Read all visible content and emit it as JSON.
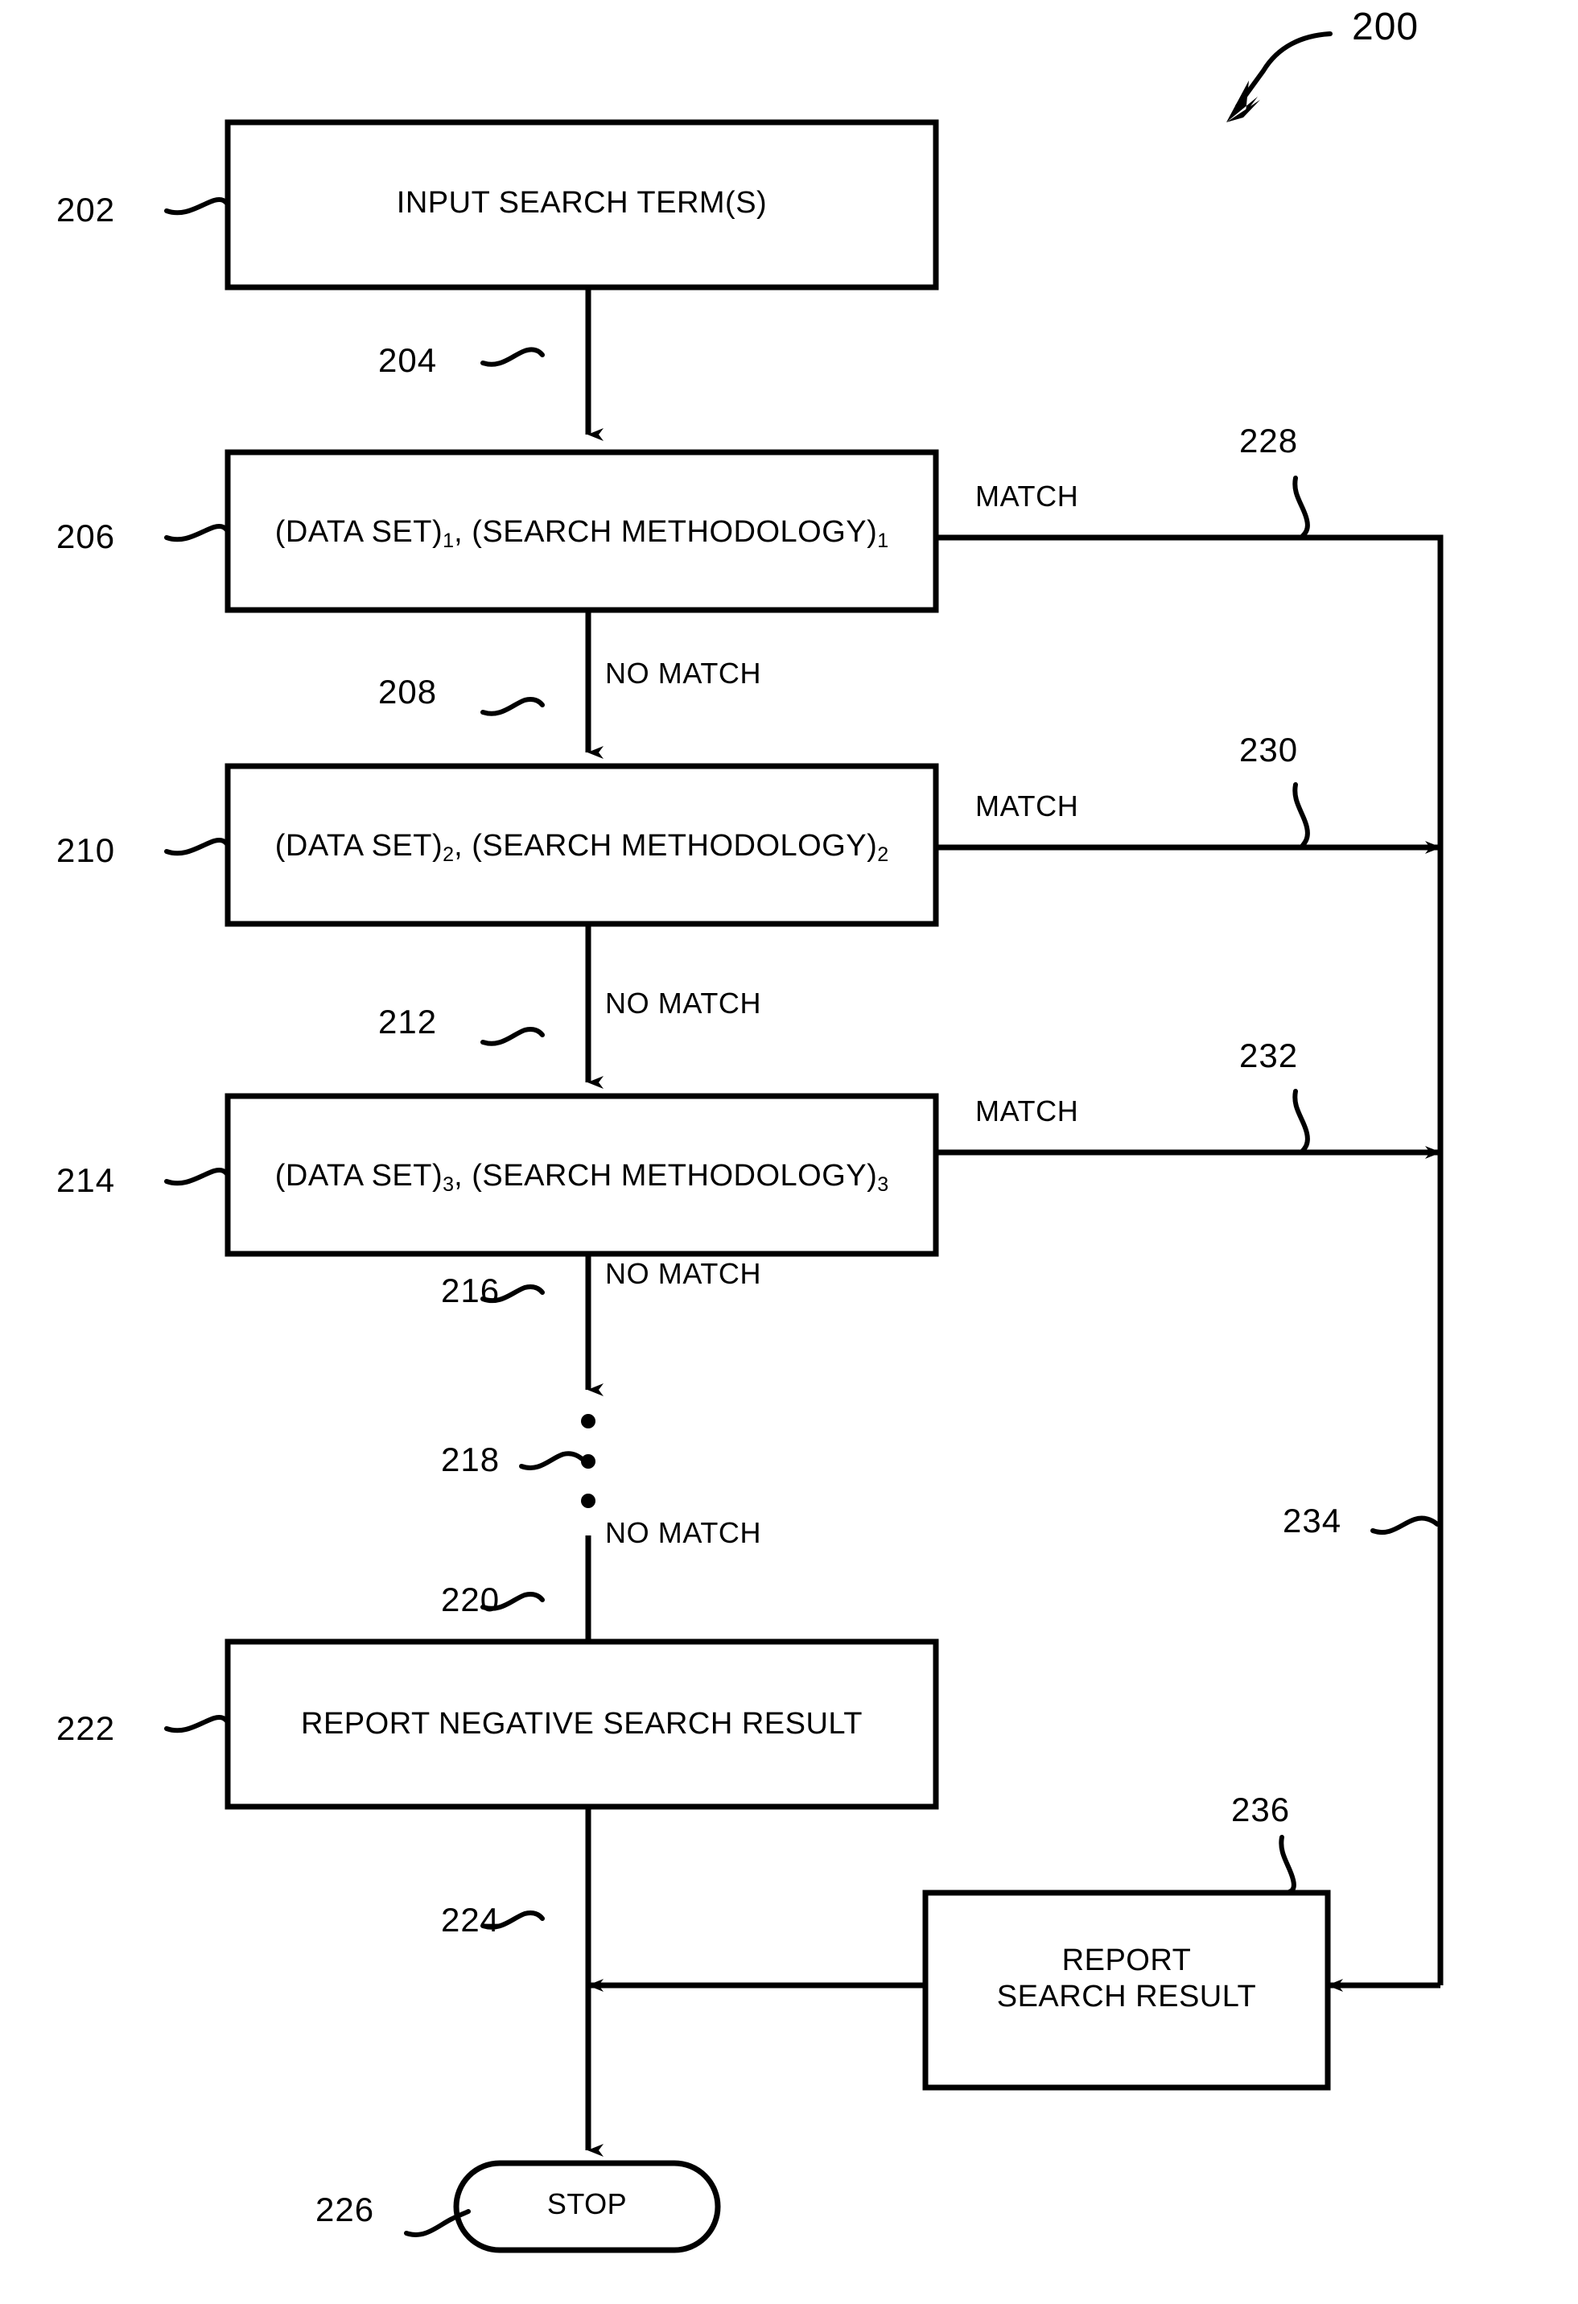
{
  "figure": {
    "number": "200",
    "type": "flowchart"
  },
  "nodes": [
    {
      "id": "202",
      "ref": "202",
      "shape": "process",
      "lines": [
        "INPUT SEARCH TERM(S)"
      ]
    },
    {
      "id": "206",
      "ref": "206",
      "shape": "process",
      "text_prefix": "(DATA SET)",
      "sub1": "1",
      "text_mid": ", (SEARCH METHODOLOGY)",
      "sub2": "1"
    },
    {
      "id": "210",
      "ref": "210",
      "shape": "process",
      "text_prefix": "(DATA SET)",
      "sub1": "2",
      "text_mid": ", (SEARCH METHODOLOGY)",
      "sub2": "2"
    },
    {
      "id": "214",
      "ref": "214",
      "shape": "process",
      "text_prefix": "(DATA SET)",
      "sub1": "3",
      "text_mid": ", (SEARCH METHODOLOGY)",
      "sub2": "3"
    },
    {
      "id": "222",
      "ref": "222",
      "shape": "process",
      "lines": [
        "REPORT NEGATIVE SEARCH RESULT"
      ]
    },
    {
      "id": "236",
      "ref": "236",
      "shape": "process",
      "lines": [
        "REPORT",
        "SEARCH RESULT"
      ]
    },
    {
      "id": "226",
      "ref": "226",
      "shape": "terminator",
      "lines": [
        "STOP"
      ]
    }
  ],
  "ellipsis": {
    "ref": "218",
    "glyph": "vertical-dots"
  },
  "edges": [
    {
      "id": "204",
      "ref": "204",
      "label": ""
    },
    {
      "id": "208",
      "ref": "208",
      "label": "NO MATCH"
    },
    {
      "id": "212",
      "ref": "212",
      "label": "NO MATCH"
    },
    {
      "id": "216",
      "ref": "216",
      "label": "NO MATCH"
    },
    {
      "id": "220",
      "ref": "220",
      "label": "NO MATCH"
    },
    {
      "id": "224",
      "ref": "224",
      "label": ""
    },
    {
      "id": "228",
      "ref": "228",
      "label": "MATCH"
    },
    {
      "id": "230",
      "ref": "230",
      "label": "MATCH"
    },
    {
      "id": "232",
      "ref": "232",
      "label": "MATCH"
    },
    {
      "id": "234",
      "ref": "234",
      "label": ""
    }
  ],
  "text": {
    "figure_ref": "200",
    "node_202_line1": "INPUT SEARCH TERM(S)",
    "node_206_prefix": "(DATA SET)",
    "node_206_sub1": "1",
    "node_206_mid": ", (SEARCH METHODOLOGY)",
    "node_206_sub2": "1",
    "node_210_prefix": "(DATA SET)",
    "node_210_sub1": "2",
    "node_210_mid": ", (SEARCH METHODOLOGY)",
    "node_210_sub2": "2",
    "node_214_prefix": "(DATA SET)",
    "node_214_sub1": "3",
    "node_214_mid": ", (SEARCH METHODOLOGY)",
    "node_214_sub2": "3",
    "node_222_line1": "REPORT NEGATIVE SEARCH RESULT",
    "node_236_line1": "REPORT",
    "node_236_line2": "SEARCH RESULT",
    "node_226_line1": "STOP",
    "ref_202": "202",
    "ref_204": "204",
    "ref_206": "206",
    "ref_208": "208",
    "ref_210": "210",
    "ref_212": "212",
    "ref_214": "214",
    "ref_216": "216",
    "ref_218": "218",
    "ref_220": "220",
    "ref_222": "222",
    "ref_224": "224",
    "ref_226": "226",
    "ref_228": "228",
    "ref_230": "230",
    "ref_232": "232",
    "ref_234": "234",
    "ref_236": "236",
    "label_match_228": "MATCH",
    "label_match_230": "MATCH",
    "label_match_232": "MATCH",
    "label_nomatch_208": "NO MATCH",
    "label_nomatch_212": "NO MATCH",
    "label_nomatch_216": "NO MATCH",
    "label_nomatch_220": "NO MATCH"
  },
  "colors": {
    "stroke": "#000000",
    "background": "#ffffff"
  }
}
